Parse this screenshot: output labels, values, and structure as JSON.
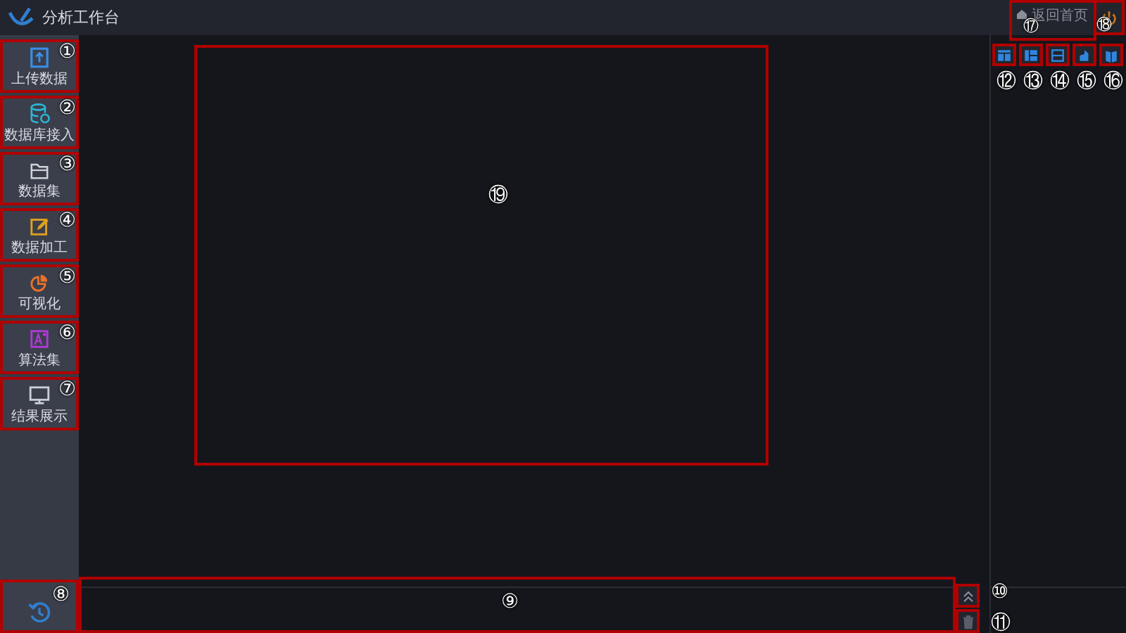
{
  "app": {
    "title": "分析工作台"
  },
  "top_right": {
    "home_link": {
      "label": "返回首页",
      "marker": "⑰"
    },
    "power_button": {
      "marker": "⑱"
    }
  },
  "sidebar": {
    "items": [
      {
        "kind": "upload",
        "label": "上传数据",
        "color": "#3a8ee6",
        "marker": "①"
      },
      {
        "kind": "database",
        "label": "数据库接入",
        "color": "#2bb5d8",
        "marker": "②"
      },
      {
        "kind": "folder",
        "label": "数据集",
        "color": "#d0d3da",
        "marker": "③"
      },
      {
        "kind": "edit",
        "label": "数据加工",
        "color": "#e0a020",
        "marker": "④"
      },
      {
        "kind": "pie",
        "label": "可视化",
        "color": "#e8702a",
        "marker": "⑤"
      },
      {
        "kind": "algorithm",
        "label": "算法集",
        "color": "#b03ad8",
        "marker": "⑥"
      },
      {
        "kind": "monitor",
        "label": "结果展示",
        "color": "#c8ccd4",
        "marker": "⑦"
      }
    ],
    "history_button": {
      "marker": "⑧"
    }
  },
  "canvas": {
    "marker": "⑲"
  },
  "bottom_panel": {
    "marker": "⑨"
  },
  "collapse_button": {
    "marker": "⑩"
  },
  "delete_button": {
    "marker": "⑪"
  },
  "layout_buttons": [
    {
      "kind": "columns",
      "marker": "⑫"
    },
    {
      "kind": "grid",
      "marker": "⑬"
    },
    {
      "kind": "rows",
      "marker": "⑭"
    },
    {
      "kind": "shape",
      "marker": "⑮"
    },
    {
      "kind": "book",
      "marker": "⑯"
    }
  ]
}
